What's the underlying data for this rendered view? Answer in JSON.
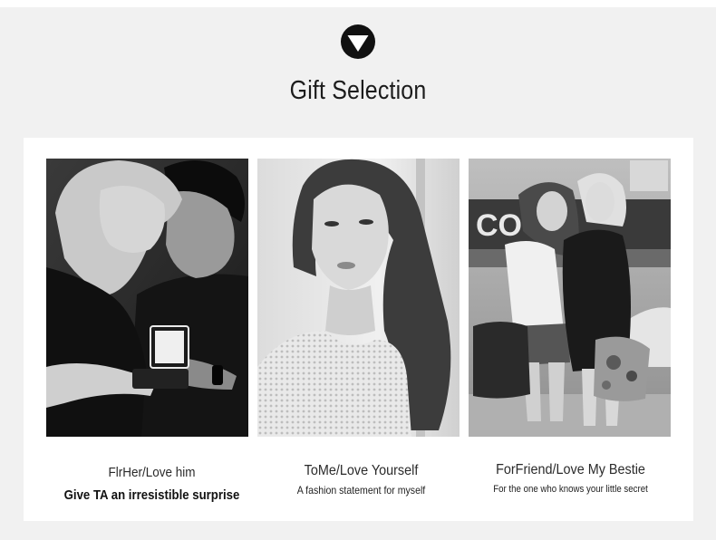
{
  "header": {
    "logo_icon": "down-triangle-in-circle-icon",
    "title": "Gift Selection"
  },
  "gifts": [
    {
      "title": "FlrHer/Love him",
      "subtitle": "Give TA an irresistible surprise",
      "image": "couple-with-ring-box-photo"
    },
    {
      "title": "ToMe/Love Yourself",
      "subtitle": "A fashion statement for myself",
      "image": "woman-portrait-photo"
    },
    {
      "title": "ForFriend/Love My Bestie",
      "subtitle": "For the one who knows your little secret",
      "image": "two-friends-hugging-photo"
    }
  ],
  "colors": {
    "background_band": "#f1f1f1",
    "card": "#ffffff",
    "text": "#1c1c1c"
  }
}
